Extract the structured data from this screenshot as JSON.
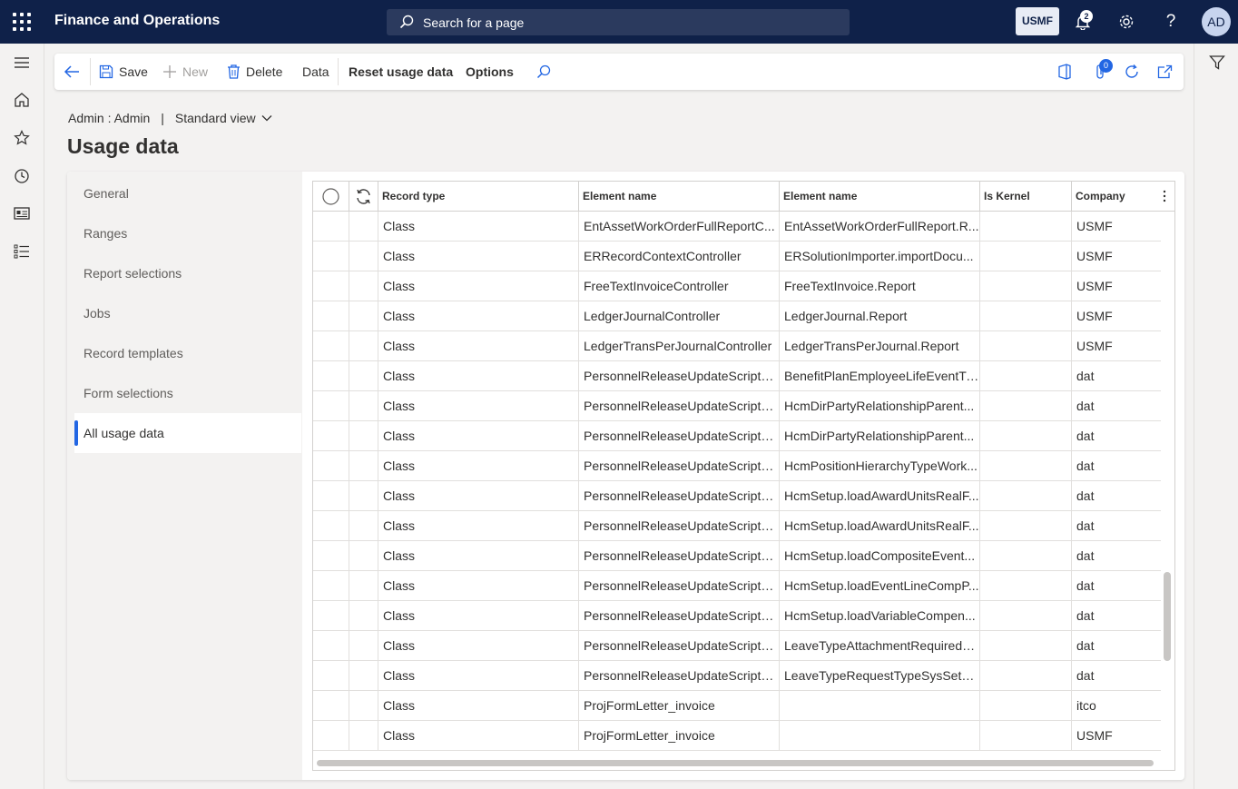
{
  "topbar": {
    "app_title": "Finance and Operations",
    "search_placeholder": "Search for a page",
    "company": "USMF",
    "notification_count": "2",
    "avatar_initials": "AD"
  },
  "actions": {
    "save": "Save",
    "new": "New",
    "delete": "Delete",
    "data": "Data",
    "reset_usage_data": "Reset usage data",
    "options": "Options",
    "attachment_count": "0"
  },
  "breadcrumb": {
    "user": "Admin : Admin",
    "view": "Standard view"
  },
  "page_title": "Usage data",
  "tabs": [
    {
      "label": "General",
      "active": false
    },
    {
      "label": "Ranges",
      "active": false
    },
    {
      "label": "Report selections",
      "active": false
    },
    {
      "label": "Jobs",
      "active": false
    },
    {
      "label": "Record templates",
      "active": false
    },
    {
      "label": "Form selections",
      "active": false
    },
    {
      "label": "All usage data",
      "active": true
    }
  ],
  "grid": {
    "columns": [
      "Record type",
      "Element name",
      "Element name",
      "Is Kernel",
      "Company"
    ],
    "rows": [
      [
        "Class",
        "EntAssetWorkOrderFullReportC...",
        "EntAssetWorkOrderFullReport.R...",
        "",
        "USMF"
      ],
      [
        "Class",
        "ERRecordContextController",
        "ERSolutionImporter.importDocu...",
        "",
        "USMF"
      ],
      [
        "Class",
        "FreeTextInvoiceController",
        "FreeTextInvoice.Report",
        "",
        "USMF"
      ],
      [
        "Class",
        "LedgerJournalController",
        "LedgerJournal.Report",
        "",
        "USMF"
      ],
      [
        "Class",
        "LedgerTransPerJournalController",
        "LedgerTransPerJournal.Report",
        "",
        "USMF"
      ],
      [
        "Class",
        "PersonnelReleaseUpdateScriptC...",
        "BenefitPlanEmployeeLifeEventTr...",
        "",
        "dat"
      ],
      [
        "Class",
        "PersonnelReleaseUpdateScriptC...",
        "HcmDirPartyRelationshipParent...",
        "",
        "dat"
      ],
      [
        "Class",
        "PersonnelReleaseUpdateScriptC...",
        "HcmDirPartyRelationshipParent...",
        "",
        "dat"
      ],
      [
        "Class",
        "PersonnelReleaseUpdateScriptC...",
        "HcmPositionHierarchyTypeWork...",
        "",
        "dat"
      ],
      [
        "Class",
        "PersonnelReleaseUpdateScriptC...",
        "HcmSetup.loadAwardUnitsRealF...",
        "",
        "dat"
      ],
      [
        "Class",
        "PersonnelReleaseUpdateScriptC...",
        "HcmSetup.loadAwardUnitsRealF...",
        "",
        "dat"
      ],
      [
        "Class",
        "PersonnelReleaseUpdateScriptC...",
        "HcmSetup.loadCompositeEvent...",
        "",
        "dat"
      ],
      [
        "Class",
        "PersonnelReleaseUpdateScriptC...",
        "HcmSetup.loadEventLineCompP...",
        "",
        "dat"
      ],
      [
        "Class",
        "PersonnelReleaseUpdateScriptC...",
        "HcmSetup.loadVariableCompen...",
        "",
        "dat"
      ],
      [
        "Class",
        "PersonnelReleaseUpdateScriptC...",
        "LeaveTypeAttachmentRequiredS...",
        "",
        "dat"
      ],
      [
        "Class",
        "PersonnelReleaseUpdateScriptC...",
        "LeaveTypeRequestTypeSysSetup...",
        "",
        "dat"
      ],
      [
        "Class",
        "ProjFormLetter_invoice",
        "",
        "",
        "itco"
      ],
      [
        "Class",
        "ProjFormLetter_invoice",
        "",
        "",
        "USMF"
      ]
    ]
  }
}
